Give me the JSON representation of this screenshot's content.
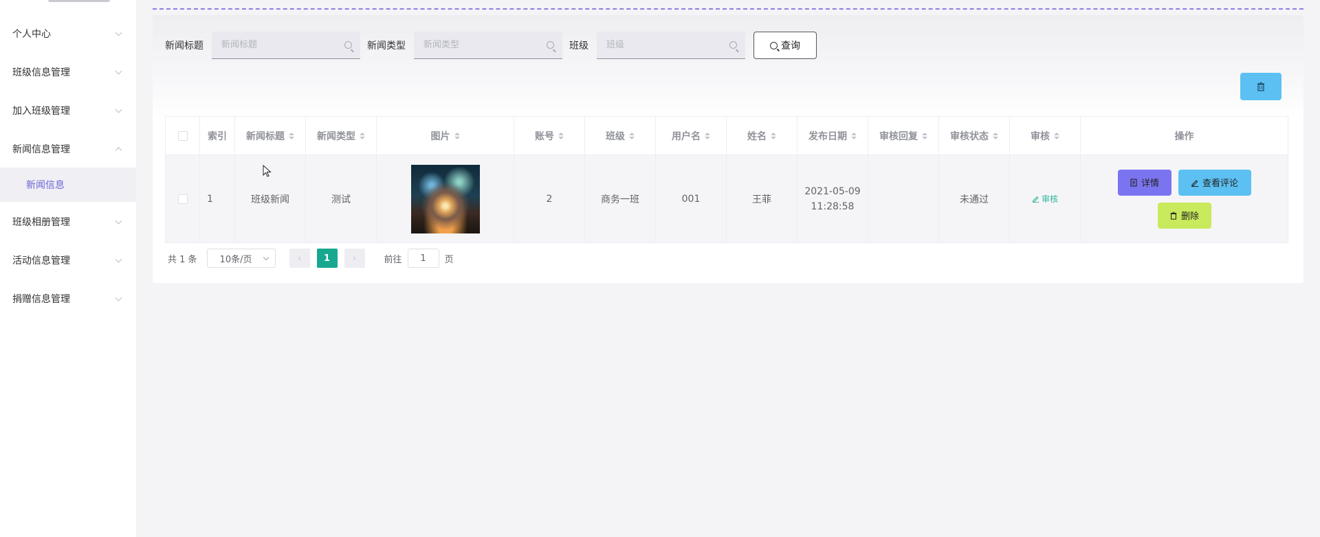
{
  "sidebar": {
    "items": [
      {
        "label": "个人中心"
      },
      {
        "label": "班级信息管理"
      },
      {
        "label": "加入班级管理"
      },
      {
        "label": "新闻信息管理"
      },
      {
        "label": "班级相册管理"
      },
      {
        "label": "活动信息管理"
      },
      {
        "label": "捐赠信息管理"
      }
    ],
    "sub_item": "新闻信息"
  },
  "filters": {
    "title_label": "新闻标题",
    "title_placeholder": "新闻标题",
    "type_label": "新闻类型",
    "type_placeholder": "新闻类型",
    "class_label": "班级",
    "class_placeholder": "班级",
    "query_label": "查询"
  },
  "table": {
    "headers": [
      "索引",
      "新闻标题",
      "新闻类型",
      "图片",
      "账号",
      "班级",
      "用户名",
      "姓名",
      "发布日期",
      "审核回复",
      "审核状态",
      "审核",
      "操作"
    ],
    "rows": [
      {
        "index": "1",
        "title": "班级新闻",
        "type": "测试",
        "account": "2",
        "class": "商务一班",
        "username": "001",
        "name": "王菲",
        "date_line1": "2021-05-09",
        "date_line2": "11:28:58",
        "reply": "",
        "status": "未通过",
        "review": "审核",
        "detail": "详情",
        "comments": "查看评论",
        "delete": "删除"
      }
    ]
  },
  "pagination": {
    "total": "共 1 条",
    "page_size": "10条/页",
    "current": "1",
    "goto_prefix": "前往",
    "goto_value": "1",
    "goto_suffix": "页"
  },
  "colors": {
    "accent_purple": "#7b74f0",
    "accent_blue": "#5cc0f2",
    "accent_lime": "#c8ea5c",
    "accent_teal": "#17a88f"
  }
}
